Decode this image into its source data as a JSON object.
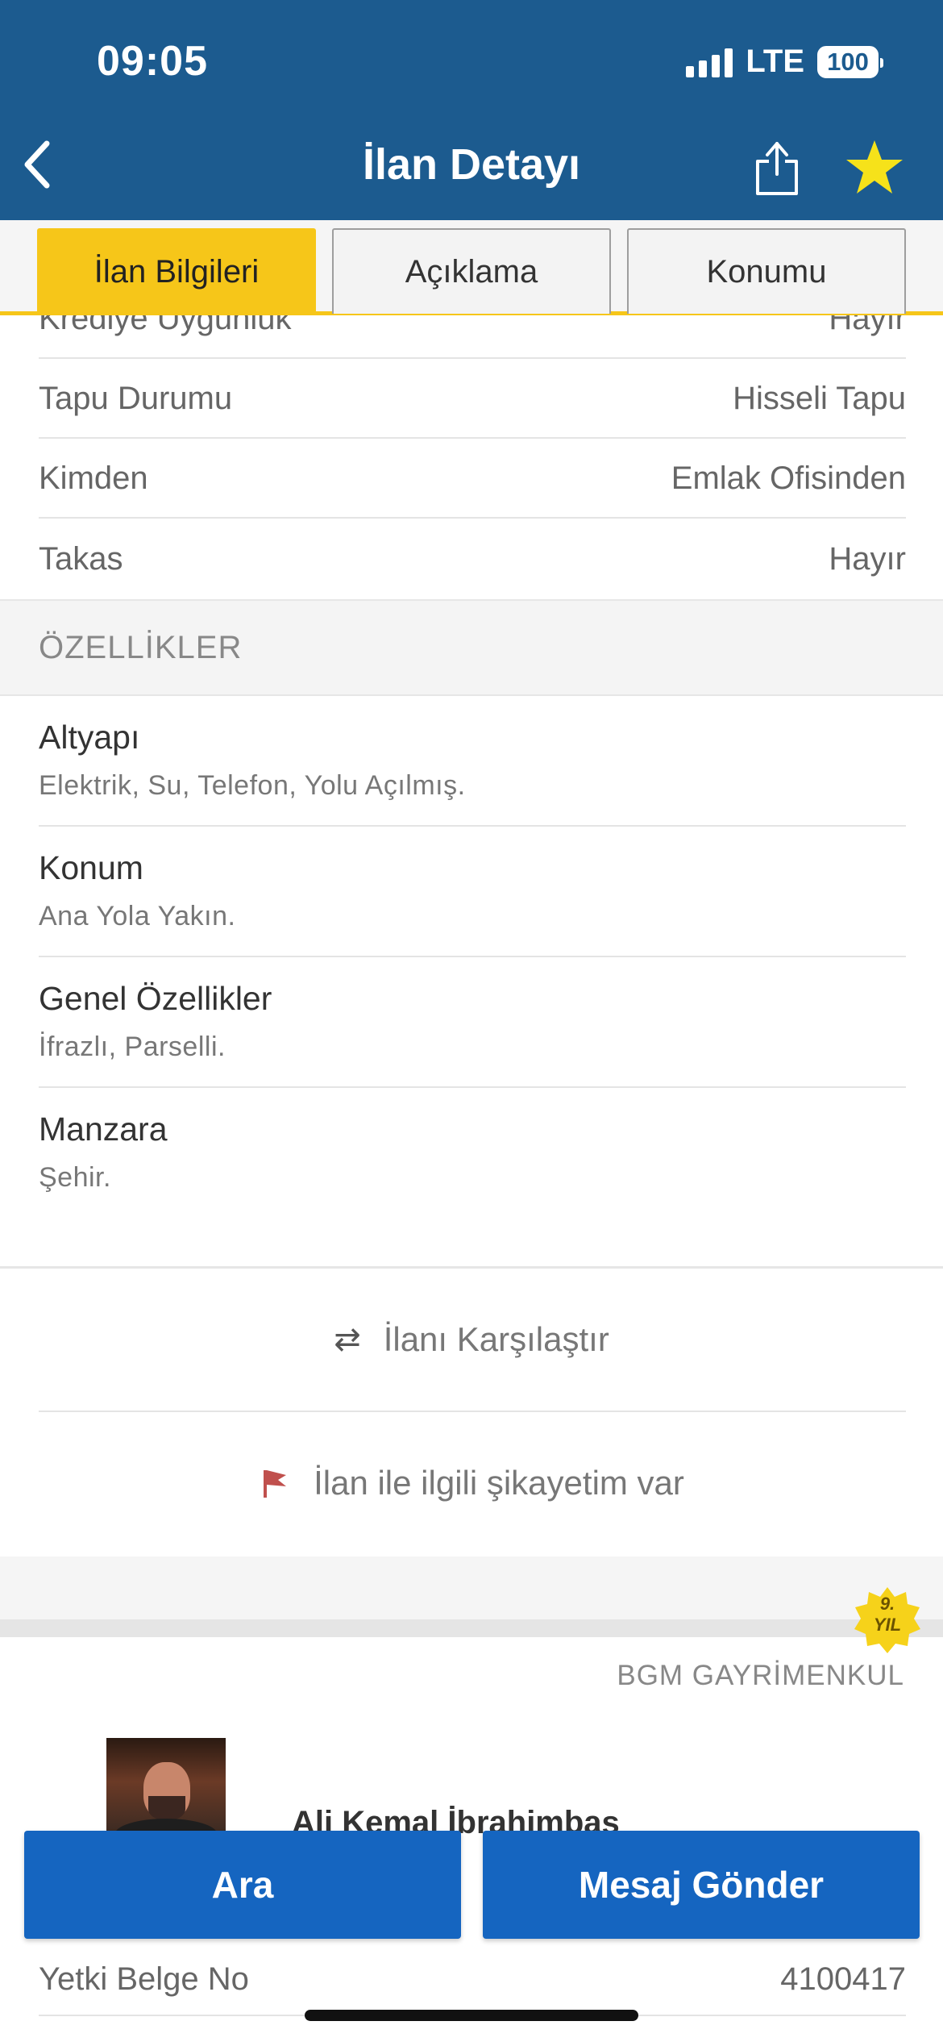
{
  "status_bar": {
    "time": "09:05",
    "network": "LTE",
    "battery": "100"
  },
  "nav": {
    "title": "İlan Detayı",
    "favorite_color": "#f6e21a"
  },
  "tabs": [
    {
      "label": "İlan Bilgileri",
      "active": true
    },
    {
      "label": "Açıklama",
      "active": false
    },
    {
      "label": "Konumu",
      "active": false
    }
  ],
  "info_rows": [
    {
      "label": "Krediye Uygunluk",
      "value": "Hayır"
    },
    {
      "label": "Tapu Durumu",
      "value": "Hisseli Tapu"
    },
    {
      "label": "Kimden",
      "value": "Emlak Ofisinden"
    },
    {
      "label": "Takas",
      "value": "Hayır"
    }
  ],
  "features_section": {
    "title": "ÖZELLİKLER",
    "items": [
      {
        "title": "Altyapı",
        "value": "Elektrik, Su, Telefon, Yolu Açılmış."
      },
      {
        "title": "Konum",
        "value": "Ana Yola Yakın."
      },
      {
        "title": "Genel Özellikler",
        "value": "İfrazlı, Parselli."
      },
      {
        "title": "Manzara",
        "value": "Şehir."
      }
    ]
  },
  "actions": {
    "compare_label": "İlanı Karşılaştır",
    "report_label": "İlan ile ilgili şikayetim var"
  },
  "store": {
    "badge_line1": "9.",
    "badge_line2": "YIL",
    "agency_name": "BGM GAYRİMENKUL",
    "agent_name": "Ali Kemal İbrahimbaş"
  },
  "cta": {
    "call_label": "Ara",
    "message_label": "Mesaj Gönder"
  },
  "license": {
    "label": "Yetki Belge No",
    "value": "4100417"
  },
  "colors": {
    "header": "#1c5b8f",
    "tab_active": "#f6c619",
    "cta": "#1565c0"
  }
}
